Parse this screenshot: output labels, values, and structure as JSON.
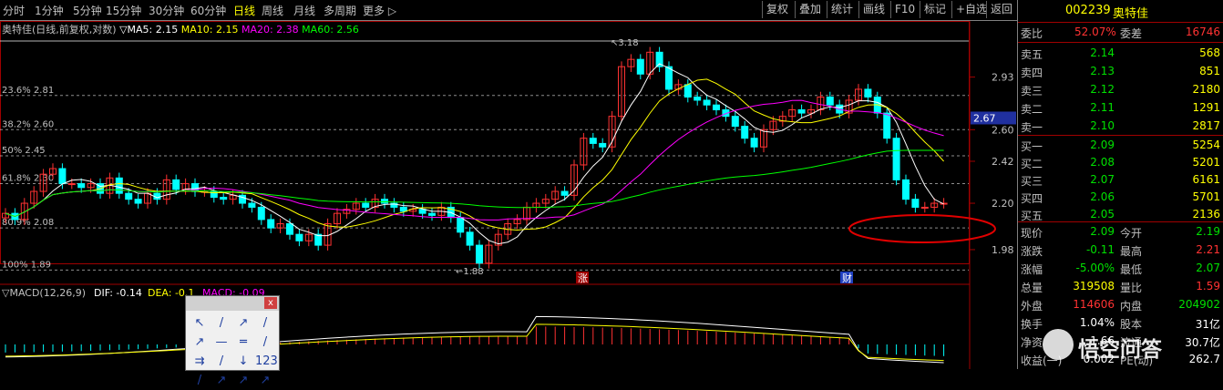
{
  "toolbar": {
    "periods": [
      "分时",
      "1分钟",
      "5分钟",
      "15分钟",
      "30分钟",
      "60分钟",
      "日线",
      "周线",
      "月线",
      "多周期",
      "更多 ▷"
    ],
    "active_period": "日线",
    "buttons": [
      "复权",
      "叠加",
      "统计",
      "画线",
      "F10",
      "标记",
      "+自选",
      "返回"
    ]
  },
  "chart": {
    "info_title": "奥特佳(日线,前复权,对数)",
    "ma_items": [
      {
        "label": "▽MA5: 2.15",
        "color": "#ffffff"
      },
      {
        "label": "MA10: 2.15",
        "color": "#ffff00"
      },
      {
        "label": "MA20: 2.38",
        "color": "#ff00ff"
      },
      {
        "label": "MA60: 2.56",
        "color": "#00ff00"
      }
    ],
    "price_ticks": [
      "2.93",
      "2.67",
      "2.60",
      "2.42",
      "2.20",
      "1.98"
    ],
    "current_price_tag": "2.67",
    "fib_labels": [
      "23.6% 2.81",
      "38.2% 2.60",
      "50% 2.45",
      "61.8% 2.30",
      "80.9% 2.08",
      "100% 1.89"
    ],
    "high_label": "3.18",
    "low_label": "1.88",
    "markers": [
      "涨",
      "财"
    ],
    "macd_title": "▽MACD(12,26,9)",
    "dif_label": "DIF: -0.14",
    "dea_label": "DEA: -0.1",
    "macd_tail": "MACD: -0.09"
  },
  "panel": {
    "code": "002239",
    "name": "奥特佳",
    "weibi_label": "委比",
    "weibi_value": "52.07%",
    "weicha_label": "委差",
    "weicha_value": "16746",
    "sells": [
      {
        "label": "卖五",
        "price": "2.14",
        "vol": "568"
      },
      {
        "label": "卖四",
        "price": "2.13",
        "vol": "851"
      },
      {
        "label": "卖三",
        "price": "2.12",
        "vol": "2180"
      },
      {
        "label": "卖二",
        "price": "2.11",
        "vol": "1291"
      },
      {
        "label": "卖一",
        "price": "2.10",
        "vol": "2817"
      }
    ],
    "buys": [
      {
        "label": "买一",
        "price": "2.09",
        "vol": "5254"
      },
      {
        "label": "买二",
        "price": "2.08",
        "vol": "5201"
      },
      {
        "label": "买三",
        "price": "2.07",
        "vol": "6161"
      },
      {
        "label": "买四",
        "price": "2.06",
        "vol": "5701"
      },
      {
        "label": "买五",
        "price": "2.05",
        "vol": "2136"
      }
    ],
    "stats": [
      {
        "l1": "现价",
        "v1": "2.09",
        "l2": "今开",
        "v2": "2.19"
      },
      {
        "l1": "涨跌",
        "v1": "-0.11",
        "l2": "最高",
        "v2": "2.21"
      },
      {
        "l1": "涨幅",
        "v1": "-5.00%",
        "l2": "最低",
        "v2": "2.07"
      },
      {
        "l1": "总量",
        "v1": "319508",
        "l2": "量比",
        "v2": "1.59"
      },
      {
        "l1": "外盘",
        "v1": "114606",
        "l2": "内盘",
        "v2": "204902"
      },
      {
        "l1": "换手",
        "v1": "1.04%",
        "l2": "股本",
        "v2": "31亿"
      },
      {
        "l1": "净资",
        "v1": "1.66",
        "l2": "流通",
        "v2": "30.7亿"
      },
      {
        "l1": "收益(一)",
        "v1": "0.002",
        "l2": "PE(动)",
        "v2": "262.7"
      }
    ]
  },
  "dialog": {
    "close": "x",
    "tools": [
      "↖",
      "/",
      "↗",
      "/",
      "↗",
      "—",
      "═",
      "/",
      "⇉",
      "/",
      "↓",
      "123",
      "/",
      "↗",
      "↗",
      "↗"
    ]
  },
  "watermark": "悟空问答",
  "colors": {
    "up": "#ff3232",
    "down": "#00ffff",
    "ma5": "#ffffff",
    "ma10": "#ffff00",
    "ma20": "#ff00ff",
    "ma60": "#00ff00",
    "grid": "#a00000"
  }
}
